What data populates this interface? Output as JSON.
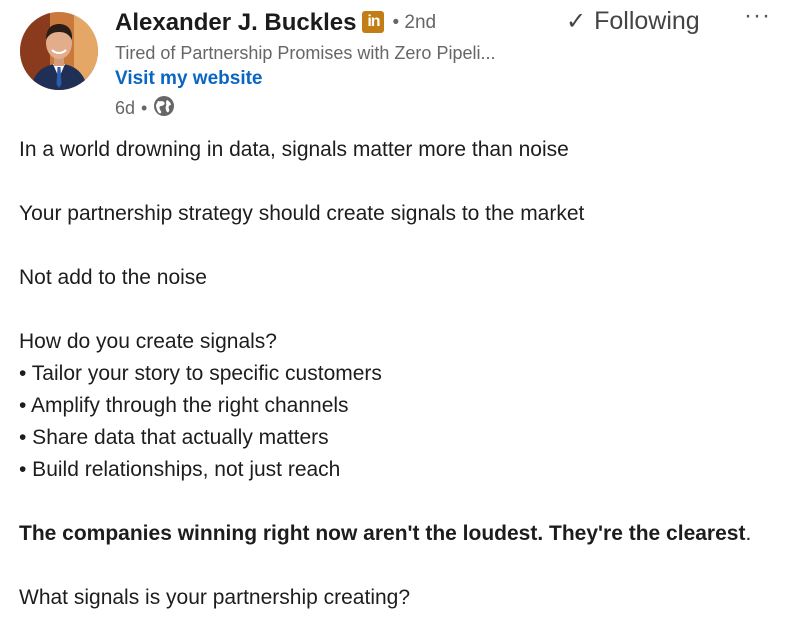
{
  "author": {
    "name": "Alexander J. Buckles",
    "badge_text": "in",
    "degree": "• 2nd",
    "headline": "Tired of Partnership Promises with Zero Pipeli...",
    "website_link": "Visit my website",
    "time": "6d",
    "time_separator": "•",
    "visibility_icon": "globe-icon"
  },
  "actions": {
    "follow_check": "✓",
    "follow_label": "Following",
    "more_label": "···"
  },
  "post": {
    "line1": "In a world drowning in data, signals matter more than noise",
    "line2": "Your partnership strategy should create signals to the market",
    "line3": "Not add to the noise",
    "line4": "How do you create signals?",
    "bullets": [
      "• Tailor your story to specific customers",
      "• Amplify through the right channels",
      "• Share data that actually matters",
      "• Build relationships, not just reach"
    ],
    "bold_line": "The companies winning right now aren't the loudest. They're the clearest",
    "bold_line_end": ".",
    "closing": "What signals is your partnership creating?"
  },
  "colors": {
    "link": "#0a66c2",
    "badge": "#c37d16",
    "secondary_text": "#666666"
  }
}
